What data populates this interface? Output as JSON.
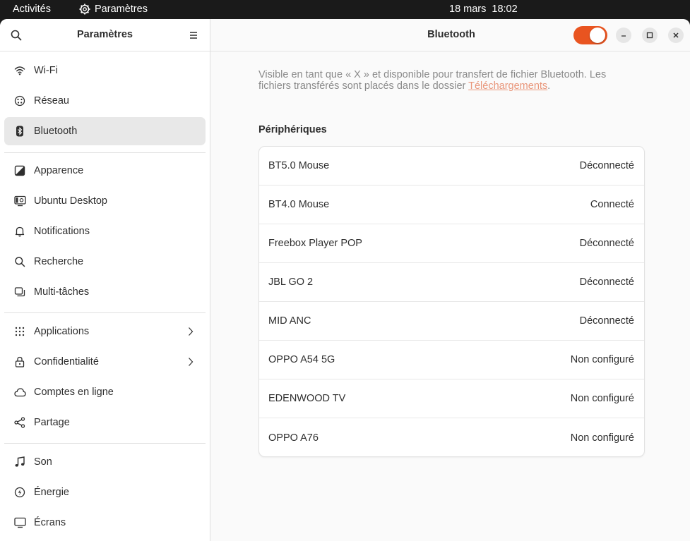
{
  "topbar": {
    "activities": "Activités",
    "app_name": "Paramètres",
    "date": "18 mars",
    "time": "18:02"
  },
  "sidebar": {
    "title": "Paramètres",
    "items": [
      {
        "label": "Wi-Fi",
        "icon": "wifi-icon"
      },
      {
        "label": "Réseau",
        "icon": "network-icon"
      },
      {
        "label": "Bluetooth",
        "icon": "bluetooth-icon",
        "active": true
      },
      {
        "label": "Apparence",
        "icon": "appearance-icon"
      },
      {
        "label": "Ubuntu Desktop",
        "icon": "ubuntu-desktop-icon"
      },
      {
        "label": "Notifications",
        "icon": "bell-icon"
      },
      {
        "label": "Recherche",
        "icon": "search-icon"
      },
      {
        "label": "Multi-tâches",
        "icon": "multitasking-icon"
      },
      {
        "label": "Applications",
        "icon": "apps-grid-icon",
        "has_submenu": true
      },
      {
        "label": "Confidentialité",
        "icon": "lock-icon",
        "has_submenu": true
      },
      {
        "label": "Comptes en ligne",
        "icon": "cloud-icon"
      },
      {
        "label": "Partage",
        "icon": "share-icon"
      },
      {
        "label": "Son",
        "icon": "music-note-icon"
      },
      {
        "label": "Énergie",
        "icon": "power-icon"
      },
      {
        "label": "Écrans",
        "icon": "display-icon"
      }
    ]
  },
  "content": {
    "title": "Bluetooth",
    "bluetooth_enabled": true,
    "accent_color": "#e95420",
    "info_text": "Visible en tant que « X » et disponible pour transfert de fichier Bluetooth. Les fichiers transférés sont placés dans le dossier ",
    "info_link": "Téléchargements",
    "info_end": ".",
    "devices_title": "Périphériques",
    "devices": [
      {
        "name": "BT5.0 Mouse",
        "status": "Déconnecté"
      },
      {
        "name": "BT4.0 Mouse",
        "status": "Connecté"
      },
      {
        "name": "Freebox Player POP",
        "status": "Déconnecté"
      },
      {
        "name": "JBL GO 2",
        "status": "Déconnecté"
      },
      {
        "name": "MID ANC",
        "status": "Déconnecté"
      },
      {
        "name": "OPPO A54 5G",
        "status": "Non configuré"
      },
      {
        "name": "EDENWOOD TV",
        "status": "Non configuré"
      },
      {
        "name": "OPPO A76",
        "status": "Non configuré"
      }
    ]
  }
}
